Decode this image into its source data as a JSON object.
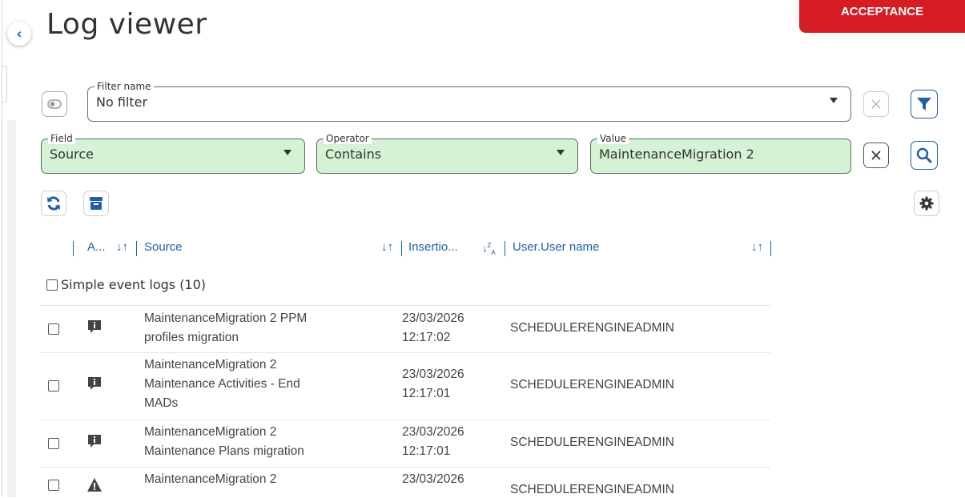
{
  "page": {
    "title": "Log viewer",
    "environment_badge": "ACCEPTANCE"
  },
  "filter": {
    "legend": "Filter name",
    "value": "No filter"
  },
  "criteria": {
    "field": {
      "legend": "Field",
      "value": "Source"
    },
    "operator": {
      "legend": "Operator",
      "value": "Contains"
    },
    "value": {
      "legend": "Value",
      "value": "MaintenanceMigration 2"
    }
  },
  "columns": {
    "type_short": "A...",
    "source": "Source",
    "insertion": "Insertio...",
    "user": "User.User name"
  },
  "group": {
    "label": "Simple event logs (10)"
  },
  "rows": [
    {
      "type_icon": "info-icon",
      "source_line1": "MaintenanceMigration 2 PPM",
      "source_line2": "profiles migration",
      "source_line3": "",
      "date": "23/03/2026",
      "time": "12:17:02",
      "user": "SCHEDULERENGINEADMIN"
    },
    {
      "type_icon": "info-icon",
      "source_line1": "MaintenanceMigration 2",
      "source_line2": "Maintenance Activities - End",
      "source_line3": "MADs",
      "date": "23/03/2026",
      "time": "12:17:01",
      "user": "SCHEDULERENGINEADMIN"
    },
    {
      "type_icon": "info-icon",
      "source_line1": "MaintenanceMigration 2",
      "source_line2": "Maintenance Plans migration",
      "source_line3": "",
      "date": "23/03/2026",
      "time": "12:17:01",
      "user": "SCHEDULERENGINEADMIN"
    },
    {
      "type_icon": "warning-icon",
      "source_line1": "MaintenanceMigration 2",
      "source_line2": "",
      "source_line3": "",
      "date": "23/03/2026",
      "time": "",
      "user": "SCHEDULERENGINEADMIN"
    }
  ],
  "colors": {
    "accent": "#1f5fa8",
    "badge": "#d71d24",
    "criteria_bg": "#d6f2d5"
  }
}
